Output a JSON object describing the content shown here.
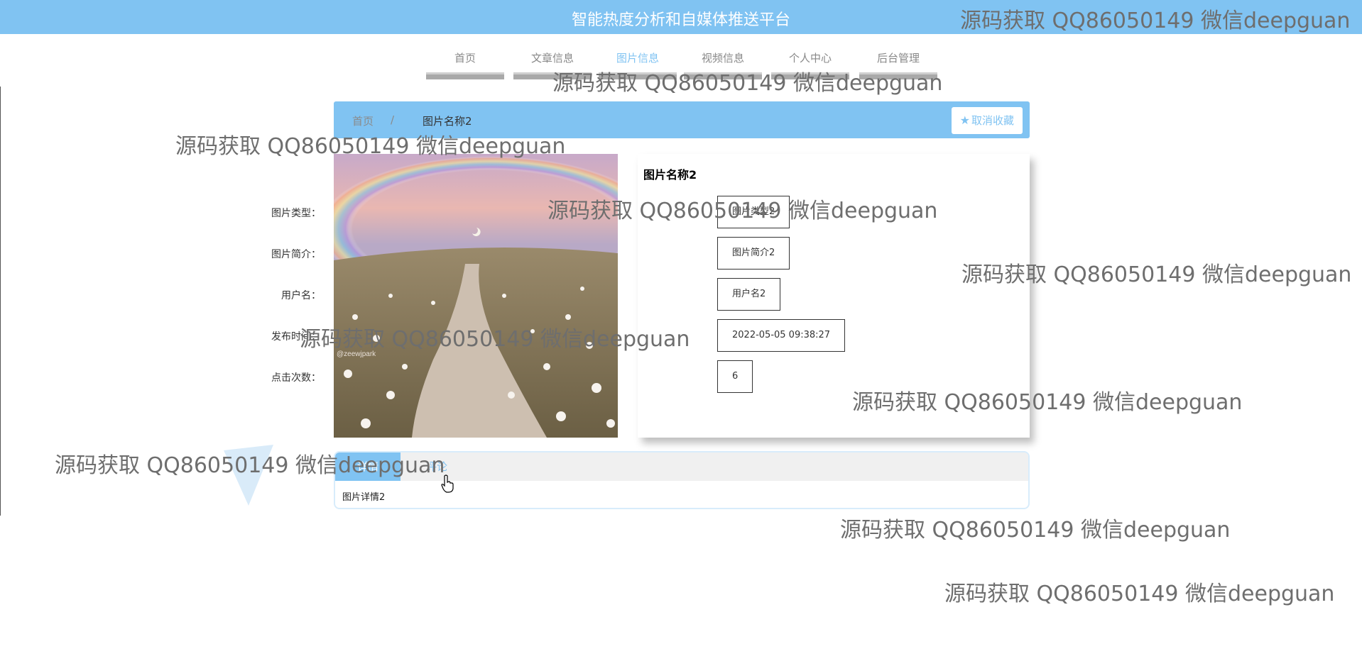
{
  "header": {
    "title": "智能热度分析和自媒体推送平台"
  },
  "nav": {
    "items": [
      {
        "label": "首页",
        "active": false
      },
      {
        "label": "文章信息",
        "active": false
      },
      {
        "label": "图片信息",
        "active": true
      },
      {
        "label": "视频信息",
        "active": false
      },
      {
        "label": "个人中心",
        "active": false
      },
      {
        "label": "后台管理",
        "active": false
      }
    ]
  },
  "breadcrumb": {
    "home": "首页",
    "separator": "/",
    "current": "图片名称2"
  },
  "favorite_button": {
    "label": "取消收藏",
    "icon": "star-icon"
  },
  "detail": {
    "title": "图片名称2",
    "fields": [
      {
        "label": "图片类型：",
        "value": "图片类型2"
      },
      {
        "label": "图片简介：",
        "value": "图片简介2"
      },
      {
        "label": "用户名：",
        "value": "用户名2"
      },
      {
        "label": "发布时间：",
        "value": "2022-05-05 09:38:27"
      },
      {
        "label": "点击次数：",
        "value": "6"
      }
    ]
  },
  "photo": {
    "caption": "@zeewjpark"
  },
  "tabs": {
    "items": [
      {
        "label": "详情"
      },
      {
        "label": "评论"
      }
    ],
    "active_index": 0,
    "content": "图片详情2"
  },
  "watermark": {
    "text": "源码获取 QQ86050149 微信deepguan"
  },
  "colors": {
    "accent": "#80c3f2",
    "header_bg": "#80c3f2"
  }
}
